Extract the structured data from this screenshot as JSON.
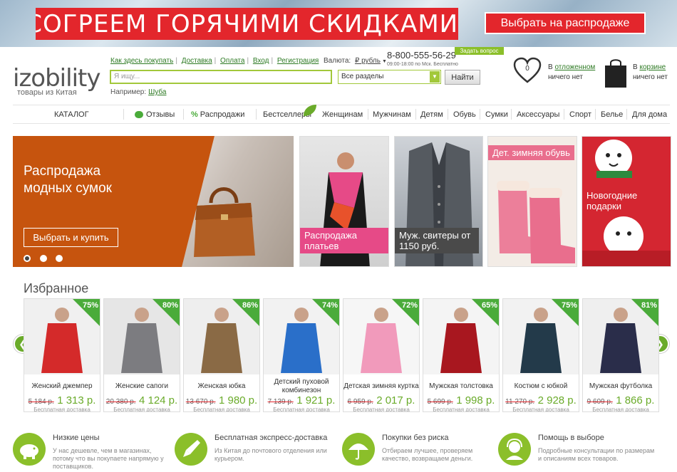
{
  "banner": {
    "headline": "СОГРЕЕМ ГОРЯЧИМИ СКИДКАМИ!",
    "cta": "Выбрать на распродаже"
  },
  "header": {
    "logo": "izobility",
    "tagline": "товары из Китая",
    "links": [
      "Как здесь покупать",
      "Доставка",
      "Оплата",
      "Вход",
      "Регистрация"
    ],
    "currency_label": "Валюта:",
    "currency_value": "₽ рубль",
    "phone": "8-800-555-56-29",
    "hours": "09:00-18:00 по Мск. Бесплатно",
    "ask_button": "Задать вопрос",
    "search_placeholder": "Я ищу...",
    "section_select": "Все разделы",
    "find_button": "Найти",
    "example_label": "Например:",
    "example_link": "Шуба",
    "deferred_count": "0",
    "deferred_prefix": "В",
    "deferred_link": "отложенном",
    "deferred_status": "ничего нет",
    "cart_prefix": "В",
    "cart_link": "корзине",
    "cart_status": "ничего нет"
  },
  "nav": {
    "catalog": "КАТАЛОГ",
    "reviews": "Отзывы",
    "sales": "Распродажи",
    "items": [
      "Бестселлеры",
      "Женщинам",
      "Мужчинам",
      "Детям",
      "Обувь",
      "Сумки",
      "Аксессуары",
      "Спорт",
      "Белье",
      "Для дома"
    ]
  },
  "hero": {
    "title": "Распродажа модных сумок",
    "button": "Выбрать и купить"
  },
  "tiles": [
    "Распродажа платьев",
    "Муж. свитеры от 1150 руб.",
    "Дет. зимняя обувь",
    "Новогодние подарки"
  ],
  "featured": {
    "title": "Избранное",
    "shipping": "Бесплатная доставка",
    "products": [
      {
        "name": "Женский джемпер",
        "discount": "75%",
        "old_price": "5 184 р.",
        "price": "1 313 р."
      },
      {
        "name": "Женские сапоги",
        "discount": "80%",
        "old_price": "20 380 р.",
        "price": "4 124 р."
      },
      {
        "name": "Женская юбка",
        "discount": "86%",
        "old_price": "13 670 р.",
        "price": "1 980 р."
      },
      {
        "name": "Детский пуховой комбинезон",
        "discount": "74%",
        "old_price": "7 139 р.",
        "price": "1 921 р."
      },
      {
        "name": "Детская зимняя куртка",
        "discount": "72%",
        "old_price": "6 959 р.",
        "price": "2 017 р."
      },
      {
        "name": "Мужская толстовка",
        "discount": "65%",
        "old_price": "5 699 р.",
        "price": "1 998 р."
      },
      {
        "name": "Костюм с юбкой",
        "discount": "75%",
        "old_price": "11 270 р.",
        "price": "2 928 р."
      },
      {
        "name": "Мужская футболка",
        "discount": "81%",
        "old_price": "9 609 р.",
        "price": "1 866 р."
      }
    ]
  },
  "features": [
    {
      "title": "Низкие цены",
      "text": "У нас дешевле, чем в магазинах, потому что вы покупаете напрямую у поставщиков."
    },
    {
      "title": "Бесплатная экспресс-доставка",
      "text": "Из Китая до почтового отделения или курьером."
    },
    {
      "title": "Покупки без риска",
      "text": "Отбираем лучшее, проверяем качество, возвращаем деньги."
    },
    {
      "title": "Помощь в выборе",
      "text": "Подробные консультации по размерам и описаниям всех товаров."
    }
  ],
  "colors": {
    "brand_green": "#6aab2a",
    "sale_red": "#e3262c",
    "hero_orange": "#c6540e"
  }
}
